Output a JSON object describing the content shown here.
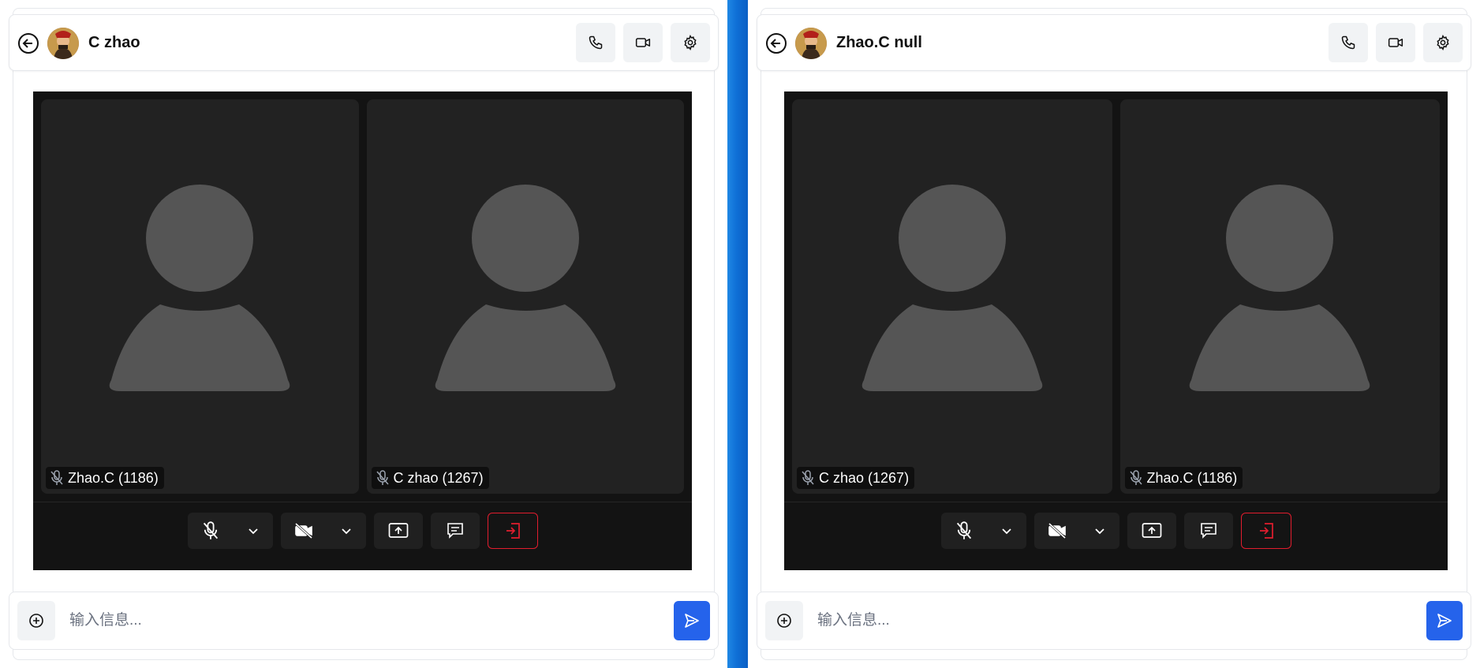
{
  "colors": {
    "video_bg": "#131313",
    "tile_bg": "#222222",
    "placeholder_avatar": "#555555",
    "leave_red": "#e11d2e",
    "send_blue": "#2563eb",
    "divider_blue": "#0f6fd6"
  },
  "left": {
    "header": {
      "contact_name": "C zhao"
    },
    "tiles": [
      {
        "label": "Zhao.C (1186)",
        "mic_icon": "mic-off-icon"
      },
      {
        "label": "C zhao (1267)",
        "mic_icon": "mic-off-icon"
      }
    ],
    "composer": {
      "placeholder": "输入信息..."
    }
  },
  "right": {
    "header": {
      "contact_name": "Zhao.C null"
    },
    "tiles": [
      {
        "label": "C zhao (1267)",
        "mic_icon": "mic-off-icon"
      },
      {
        "label": "Zhao.C (1186)",
        "mic_icon": "mic-off-icon"
      }
    ],
    "composer": {
      "placeholder": "输入信息..."
    }
  },
  "icons": {
    "back": "arrow-left-circle-icon",
    "call": "phone-icon",
    "video": "video-camera-icon",
    "settings": "gear-icon",
    "mic": "mic-off-icon",
    "camera": "video-off-icon",
    "share": "screen-share-icon",
    "chat": "chat-icon",
    "leave": "leave-icon",
    "attach": "plus-circle-icon",
    "send": "send-icon"
  }
}
